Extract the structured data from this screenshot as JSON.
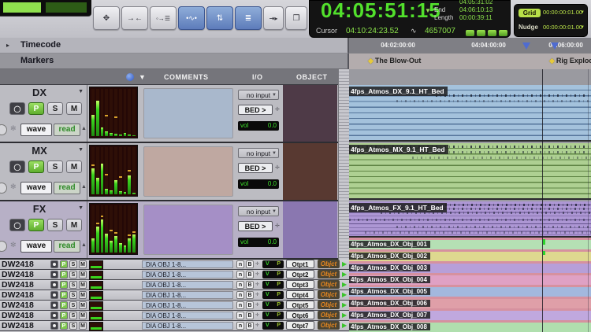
{
  "colors": {
    "accent_green": "#52e02c",
    "grid_green": "#b8e048",
    "marker_yellow": "#e6c93c",
    "object_orange": "#e8871e",
    "selection_blue": "#4f6cd0"
  },
  "toolbar": {
    "buttons": [
      {
        "name": "zoom-toggle-button",
        "glyph": "✥",
        "active": false
      },
      {
        "name": "trim-converge-button",
        "glyph": "→←",
        "active": false
      },
      {
        "name": "insertion-follows-playback-button",
        "glyph": "◦→☰",
        "active": false
      },
      {
        "name": "tab-to-transients-button",
        "glyph": "•∿•",
        "active": true
      },
      {
        "name": "mirrored-editing-button",
        "glyph": "⇅",
        "active": true
      },
      {
        "name": "layered-editing-button",
        "glyph": "≣",
        "active": true
      },
      {
        "name": "insertion-marker-button",
        "glyph": "⇥▸",
        "active": false
      },
      {
        "name": "link-timeline-edit-button",
        "glyph": "❐",
        "active": false
      }
    ]
  },
  "counter": {
    "main_time": "04:05:51:15",
    "selection_rows": [
      {
        "label": "",
        "value": "04:05:31:02"
      },
      {
        "label": "End",
        "value": "04:06:10:13"
      },
      {
        "label": "Length",
        "value": "00:00:39:11"
      }
    ],
    "cursor_label": "Cursor",
    "cursor_value": "04:10:24:23.52",
    "waveform_icon": "∿",
    "cursor_samples": "4657007"
  },
  "grid_nudge": {
    "grid_label": "Grid",
    "grid_value": "00:00:00:01.00",
    "nudge_label": "Nudge",
    "nudge_value": "00:00:00:01.00"
  },
  "rulers": {
    "timecode_label": "Timecode",
    "markers_label": "Markers",
    "ticks": [
      "04:02:00:00",
      "04:04:00:00",
      "04:06:00:00"
    ],
    "markers": [
      {
        "name": "The Blow-Out"
      },
      {
        "name": "Rig Explode"
      }
    ]
  },
  "column_headers": {
    "comments": "COMMENTS",
    "io": "I/O",
    "object": "OBJECT"
  },
  "bed_tracks": [
    {
      "name": "DX",
      "record": "",
      "input_btn": "P",
      "solo": "S",
      "mute": "M",
      "wave_label": "wave",
      "automation": "read",
      "io_input": "no input",
      "io_output": "BED >",
      "vol_label": "vol",
      "vol_value": "0.0",
      "comment_color": "#a9b8cc",
      "object_color": "#4e3a47",
      "clip_name": "4fps_Atmos_DX_9.1_HT_Bed",
      "clip_color": "#a4c2dc",
      "lane_color": "#54749a",
      "meter": {
        "levels": [
          45,
          75,
          18,
          10,
          6,
          5,
          4,
          6,
          3,
          2
        ],
        "peaks": [
          0,
          0,
          0,
          42,
          0,
          38,
          0,
          0,
          0,
          0
        ]
      }
    },
    {
      "name": "MX",
      "record": "",
      "input_btn": "P",
      "solo": "S",
      "mute": "M",
      "wave_label": "wave",
      "automation": "read",
      "io_input": "no input",
      "io_output": "BED >",
      "vol_label": "vol",
      "vol_value": "0.0",
      "comment_color": "#bfa8a1",
      "object_color": "#583931",
      "clip_name": "4fps_Atmos_MX_9.1_HT_Bed",
      "clip_color": "#aed092",
      "lane_color": "#5f8444",
      "meter": {
        "levels": [
          55,
          35,
          65,
          12,
          8,
          30,
          6,
          5,
          40,
          4
        ],
        "peaks": [
          60,
          0,
          0,
          40,
          0,
          0,
          35,
          0,
          48,
          0
        ]
      }
    },
    {
      "name": "FX",
      "record": "",
      "input_btn": "P",
      "solo": "S",
      "mute": "M",
      "wave_label": "wave",
      "automation": "read",
      "io_input": "no input",
      "io_output": "BED >",
      "vol_label": "vol",
      "vol_value": "0.0",
      "comment_color": "#a58fc6",
      "object_color": "#8a77b0",
      "clip_name": "4fps_Atmos_FX_9.1_HT_Bed",
      "clip_color": "#ad97d4",
      "lane_color": "#64528c",
      "meter": {
        "levels": [
          30,
          55,
          70,
          40,
          25,
          35,
          20,
          15,
          30,
          38
        ],
        "peaks": [
          0,
          60,
          75,
          0,
          45,
          40,
          0,
          0,
          35,
          42
        ]
      }
    }
  ],
  "dw_tracks": [
    {
      "name": "DW2418",
      "input_btn": "P",
      "solo": "S",
      "mute": "M",
      "comment": "DIA OBJ 1-8...",
      "n": "n",
      "b": "B",
      "v": "V",
      "p": "P",
      "output": "Otpt1",
      "object_label": "Objct"
    },
    {
      "name": "DW2418",
      "input_btn": "P",
      "solo": "S",
      "mute": "M",
      "comment": "DIA OBJ 1-8...",
      "n": "n",
      "b": "B",
      "v": "V",
      "p": "P",
      "output": "Otpt2",
      "object_label": "Objct"
    },
    {
      "name": "DW2418",
      "input_btn": "P",
      "solo": "S",
      "mute": "M",
      "comment": "DIA OBJ 1-8...",
      "n": "n",
      "b": "B",
      "v": "V",
      "p": "P",
      "output": "Otpt3",
      "object_label": "Objct"
    },
    {
      "name": "DW2418",
      "input_btn": "P",
      "solo": "S",
      "mute": "M",
      "comment": "DIA OBJ 1-8...",
      "n": "n",
      "b": "B",
      "v": "V",
      "p": "P",
      "output": "Otpt4",
      "object_label": "Objct"
    },
    {
      "name": "DW2418",
      "input_btn": "P",
      "solo": "S",
      "mute": "M",
      "comment": "DIA OBJ 1-8...",
      "n": "n",
      "b": "B",
      "v": "V",
      "p": "P",
      "output": "Otpt5",
      "object_label": "Objct"
    },
    {
      "name": "DW2418",
      "input_btn": "P",
      "solo": "S",
      "mute": "M",
      "comment": "DIA OBJ 1-8...",
      "n": "n",
      "b": "B",
      "v": "V",
      "p": "P",
      "output": "Otpt6",
      "object_label": "Objct"
    },
    {
      "name": "DW2418",
      "input_btn": "P",
      "solo": "S",
      "mute": "M",
      "comment": "DIA OBJ 1-8...",
      "n": "n",
      "b": "B",
      "v": "V",
      "p": "P",
      "output": "Otpt7",
      "object_label": "Objct"
    }
  ],
  "object_clips": [
    {
      "name": "4fps_Atmos_DX_Obj_001",
      "color": "#b5e0b4"
    },
    {
      "name": "4fps_Atmos_DX_Obj_002",
      "color": "#ded88f"
    },
    {
      "name": "4fps_Atmos_DX_Obj_003",
      "color": "#b79fd8"
    },
    {
      "name": "4fps_Atmos_DX_Obj_004",
      "color": "#dfa1c4"
    },
    {
      "name": "4fps_Atmos_DX_Obj_005",
      "color": "#a3b8de"
    },
    {
      "name": "4fps_Atmos_DX_Obj_006",
      "color": "#df9fa8"
    },
    {
      "name": "4fps_Atmos_DX_Obj_007",
      "color": "#c0a8de"
    },
    {
      "name": "4fps_Atmos_DX_Obj_008",
      "color": "#b0dfae"
    }
  ]
}
